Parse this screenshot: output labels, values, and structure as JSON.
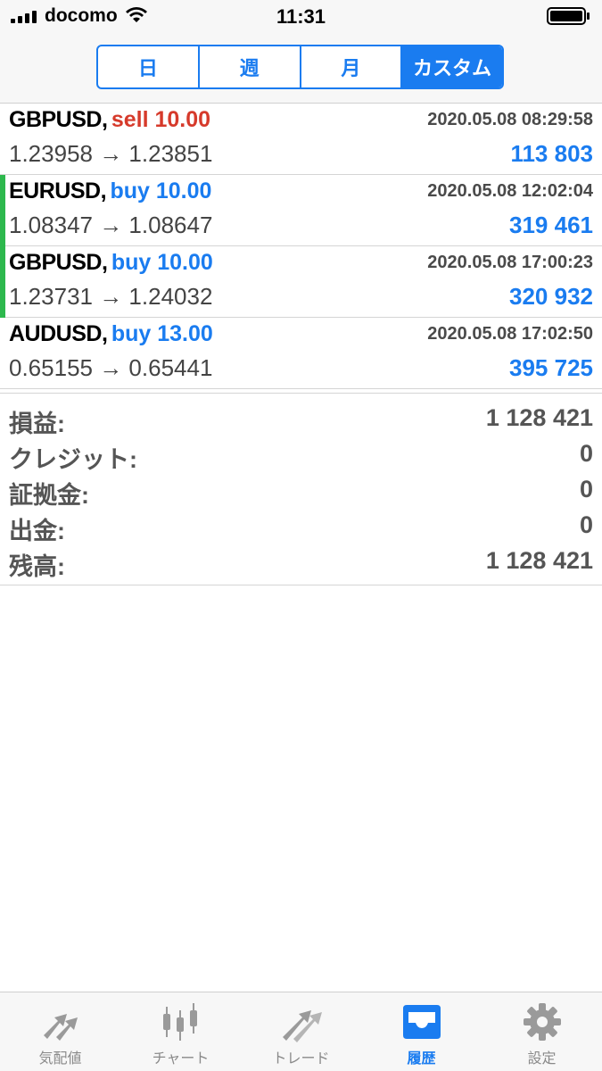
{
  "status_bar": {
    "carrier": "docomo",
    "time": "11:31"
  },
  "segments": [
    {
      "label": "日",
      "active": false
    },
    {
      "label": "週",
      "active": false
    },
    {
      "label": "月",
      "active": false
    },
    {
      "label": "カスタム",
      "active": true
    }
  ],
  "trades": [
    {
      "symbol": "GBPUSD,",
      "side": "sell 10.00",
      "type": "sell",
      "time": "2020.05.08 08:29:58",
      "prices": "1.23958 → 1.23851",
      "profit": "113 803",
      "accent": false
    },
    {
      "symbol": "EURUSD,",
      "side": "buy 10.00",
      "type": "buy",
      "time": "2020.05.08 12:02:04",
      "prices": "1.08347 → 1.08647",
      "profit": "319 461",
      "accent": true
    },
    {
      "symbol": "GBPUSD,",
      "side": "buy 10.00",
      "type": "buy",
      "time": "2020.05.08 17:00:23",
      "prices": "1.23731 → 1.24032",
      "profit": "320 932",
      "accent": true
    },
    {
      "symbol": "AUDUSD,",
      "side": "buy 13.00",
      "type": "buy",
      "time": "2020.05.08 17:02:50",
      "prices": "0.65155 → 0.65441",
      "profit": "395 725",
      "accent": false
    }
  ],
  "summary": [
    {
      "label": "損益:",
      "value": "1 128 421"
    },
    {
      "label": "クレジット:",
      "value": "0"
    },
    {
      "label": "証拠金:",
      "value": "0"
    },
    {
      "label": "出金:",
      "value": "0"
    },
    {
      "label": "残高:",
      "value": "1 128 421"
    }
  ],
  "tabs": [
    {
      "label": "気配値",
      "icon": "quotes-arrows-icon",
      "active": false
    },
    {
      "label": "チャート",
      "icon": "candlestick-chart-icon",
      "active": false
    },
    {
      "label": "トレード",
      "icon": "trade-arrows-icon",
      "active": false
    },
    {
      "label": "履歴",
      "icon": "inbox-tray-icon",
      "active": true
    },
    {
      "label": "設定",
      "icon": "gear-icon",
      "active": false
    }
  ],
  "colors": {
    "accent_blue": "#1a7cf0",
    "sell_red": "#d63a2b",
    "profit_green_bar": "#2db84d"
  }
}
